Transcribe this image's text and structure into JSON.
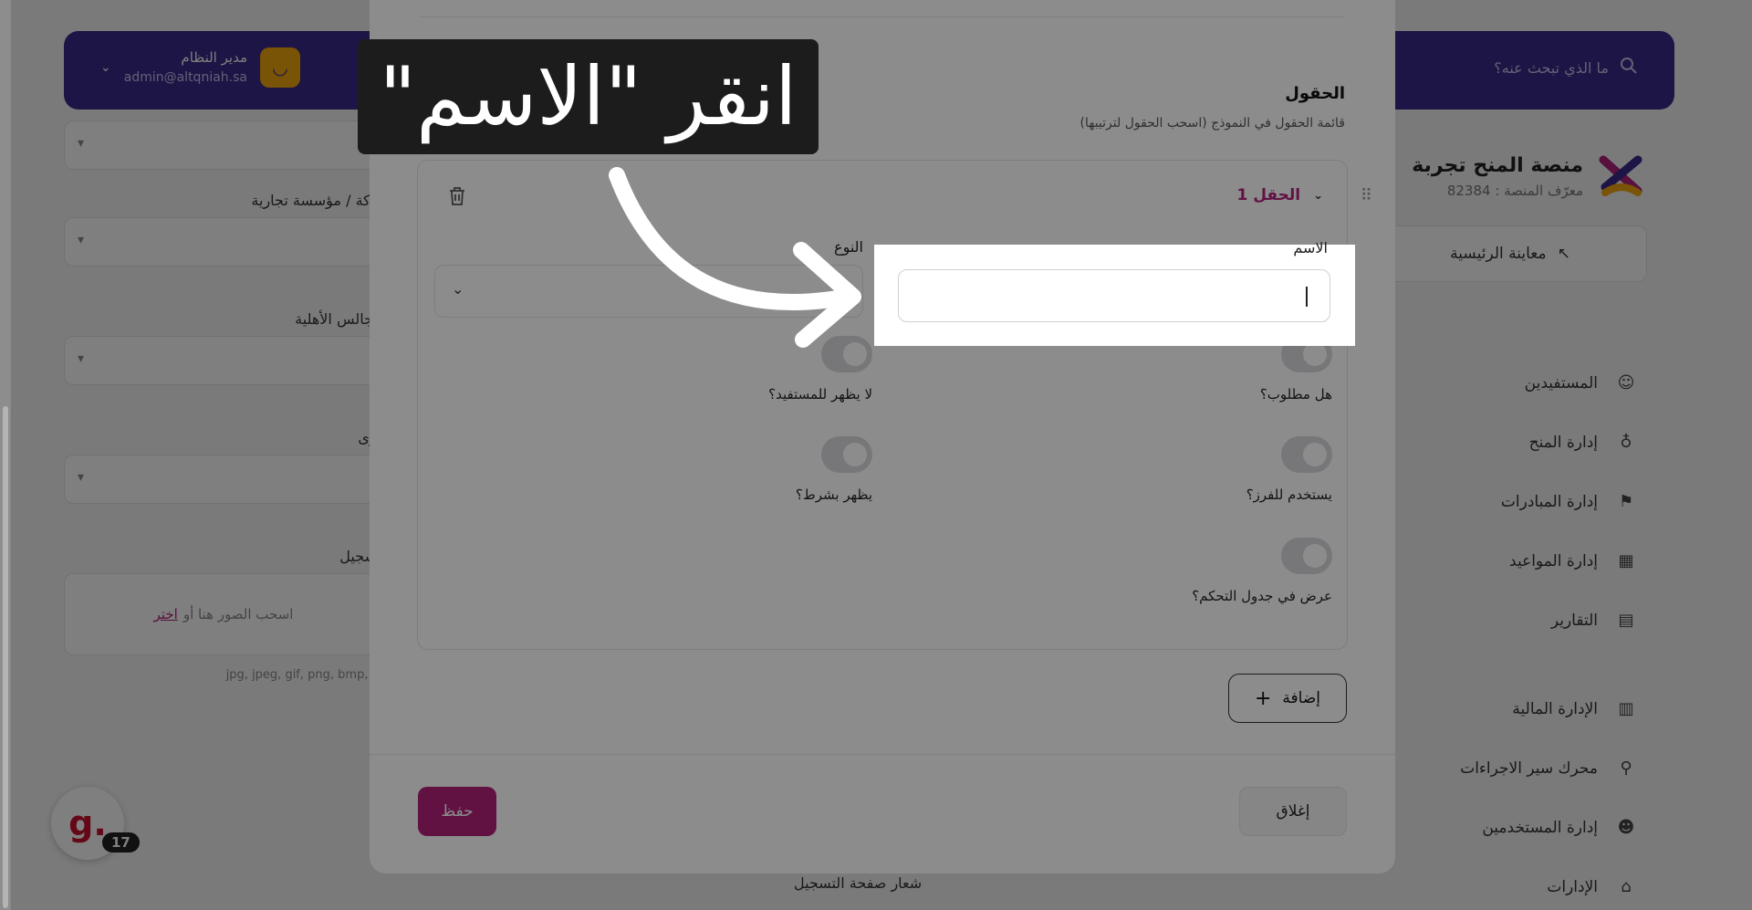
{
  "topbar": {
    "search_placeholder": "ما الذي تبحث عنه؟",
    "user_name": "مدير النظام",
    "user_email": "admin@altqniah.sa"
  },
  "sidebar": {
    "platform_name": "منصة المنح تجربة",
    "platform_id": "معرّف المنصة : 82384",
    "preview_label": "معاينة الرئيسية",
    "items": [
      {
        "label": "المستفيدين",
        "icon": "user-circle-icon"
      },
      {
        "label": "إدارة المنح",
        "icon": "hand-gift-icon"
      },
      {
        "label": "إدارة المبادرات",
        "icon": "flag-icon"
      },
      {
        "label": "إدارة المواعيد",
        "icon": "calendar-icon"
      },
      {
        "label": "التقارير",
        "icon": "report-icon"
      },
      {
        "label": "الإدارة المالية",
        "icon": "finance-icon"
      },
      {
        "label": "محرك سير الاجراءات",
        "icon": "workflow-icon"
      },
      {
        "label": "إدارة المستخدمين",
        "icon": "users-icon"
      },
      {
        "label": "الإدارات",
        "icon": "departments-icon"
      }
    ]
  },
  "background_form": {
    "label_company": "شركة / مؤسسة تجارية",
    "label_councils": "المجالس الأهلية",
    "label_other": "أخرى",
    "label_registration": "التسجيل",
    "upload_text": "اسحب الصور هنا أو",
    "upload_link": "اختر",
    "extensions": "jpg, jpeg, gif, png, bmp, ...",
    "footer_label": "شعار صفحة التسجيل"
  },
  "chat": {
    "letter": "g.",
    "badge": "17"
  },
  "modal": {
    "section_title": "الحقول",
    "section_desc": "قائمة الحقول في النموذج (اسحب الحقول لترتيبها)",
    "field": {
      "title": "الحقل 1",
      "name_label": "الاسم",
      "name_value": "",
      "type_label": "النوع",
      "type_value": "",
      "toggles": {
        "required": "هل مطلوب؟",
        "hidden_beneficiary": "لا يظهر للمستفيد؟",
        "used_for_sorting": "يستخدم للفرز؟",
        "conditional": "يظهر بشرط؟",
        "show_in_dashboard": "عرض في جدول التحكم؟"
      }
    },
    "add_label": "إضافة",
    "save_label": "حفظ",
    "close_label": "إغلاق"
  },
  "tutorial": {
    "instruction": "انقر \"الاسم\""
  },
  "colors": {
    "brand_purple": "#3a2a8a",
    "accent_magenta": "#b0217a",
    "callout_bg": "#1c1c1c"
  }
}
